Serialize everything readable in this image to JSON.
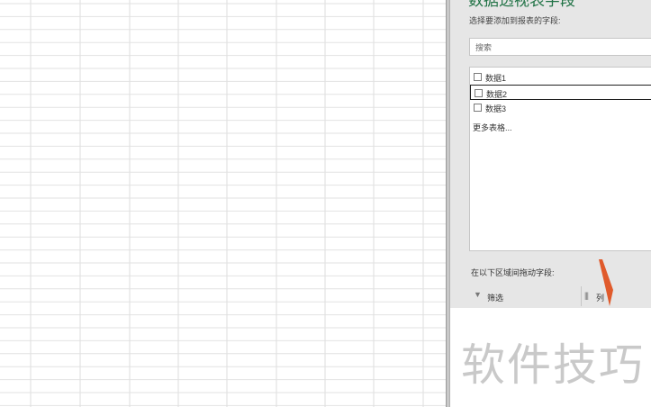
{
  "pivot_pane": {
    "title": "数据透视表字段",
    "subtitle": "选择要添加到报表的字段:",
    "search_placeholder": "搜索",
    "fields": [
      {
        "label": "数据1",
        "checked": false
      },
      {
        "label": "数据2",
        "checked": false
      },
      {
        "label": "数据3",
        "checked": false
      }
    ],
    "more_tables": "更多表格...",
    "drag_label": "在以下区域间拖动字段:",
    "areas": {
      "filter": "筛选",
      "columns": "列"
    }
  },
  "watermark": "软件技巧",
  "colors": {
    "accent": "#217346",
    "arrow": "#e05a2b"
  }
}
